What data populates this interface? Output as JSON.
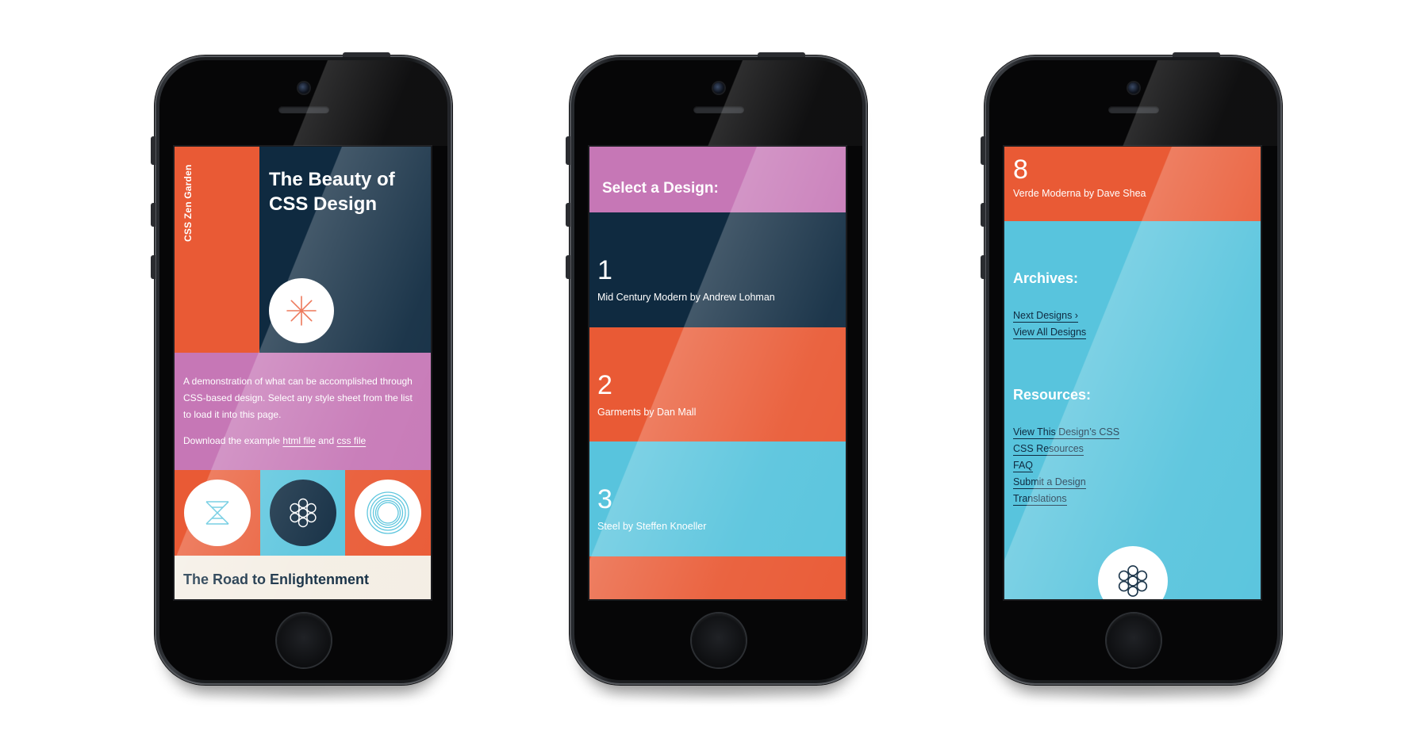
{
  "phones": {
    "home": {
      "sidebar_label": "CSS Zen Garden",
      "title": "The Beauty of CSS Design",
      "intro_text": "A demonstration of what can be accomplished through CSS-based design. Select any style sheet from the list to load it into this page.",
      "download": {
        "prefix": "Download the example",
        "html_link": "html file",
        "conjunction": "and",
        "css_link": "css file"
      },
      "footer_heading": "The Road to Enlightenment",
      "icons": [
        "asterisk-icon",
        "hourglass-icon",
        "flower-icon",
        "concentric-rings-icon"
      ]
    },
    "design_list": {
      "heading": "Select a Design:",
      "designs": [
        {
          "number": "1",
          "name": "Mid Century Modern by Andrew Lohman"
        },
        {
          "number": "2",
          "name": "Garments by Dan Mall"
        },
        {
          "number": "3",
          "name": "Steel by Steffen Knoeller"
        }
      ]
    },
    "archives": {
      "current": {
        "number": "8",
        "name": "Verde Moderna by Dave Shea"
      },
      "archives_heading": "Archives:",
      "archives_links": [
        "Next Designs ›",
        "View All Designs"
      ],
      "resources_heading": "Resources:",
      "resources_links": [
        "View This Design’s CSS",
        "CSS Resources",
        "FAQ",
        "Submit a Design",
        "Translations"
      ]
    }
  },
  "colors": {
    "orange": "#e95a35",
    "navy": "#0f2a40",
    "pink": "#c677b6",
    "cyan": "#58c4dd",
    "cream": "#f4eee4",
    "phone_body": "#1c1e21"
  }
}
